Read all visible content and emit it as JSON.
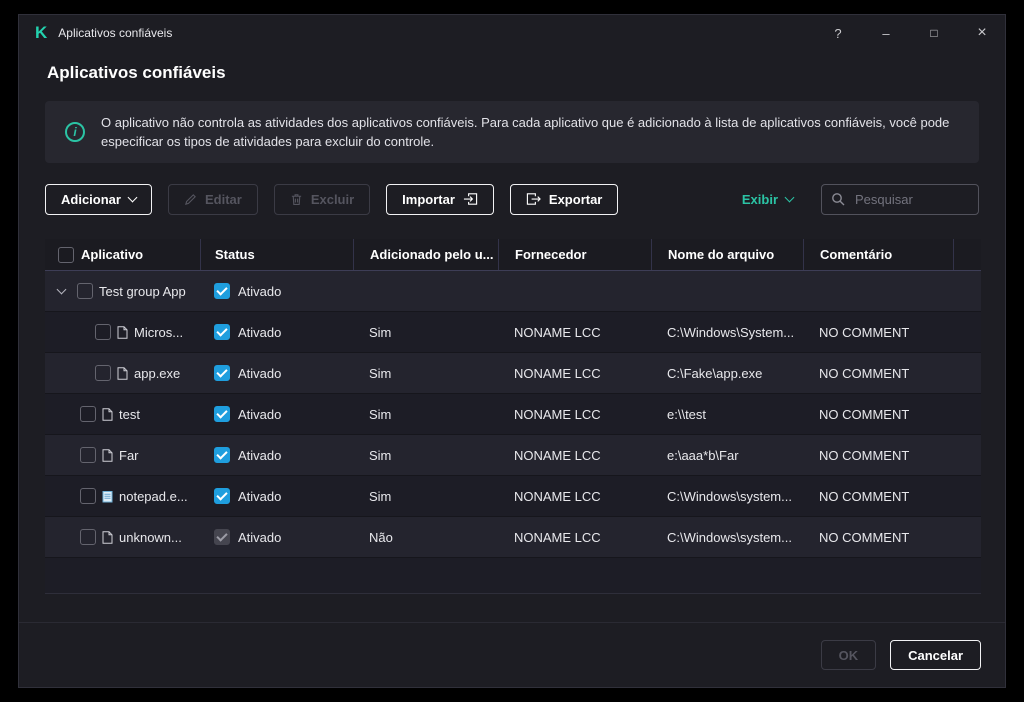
{
  "window": {
    "logo": "K",
    "title": "Aplicativos confiáveis",
    "controls": {
      "help": "?",
      "minimize": "–",
      "maximize": "□",
      "close": "×"
    }
  },
  "page": {
    "heading": "Aplicativos confiáveis",
    "banner_text": "O aplicativo não controla as atividades dos aplicativos confiáveis. Para cada aplicativo que é adicionado à lista de aplicativos confiáveis, você pode especificar os tipos de atividades para excluir do controle."
  },
  "toolbar": {
    "add_label": "Adicionar",
    "edit_label": "Editar",
    "delete_label": "Excluir",
    "import_label": "Importar",
    "export_label": "Exportar",
    "view_label": "Exibir",
    "search_placeholder": "Pesquisar"
  },
  "table": {
    "columns": {
      "app": "Aplicativo",
      "status": "Status",
      "added_by_user": "Adicionado pelo u...",
      "vendor": "Fornecedor",
      "file_name": "Nome do arquivo",
      "comment": "Comentário"
    },
    "group_row": {
      "name": "Test group App",
      "status_label": "Ativado"
    },
    "rows": [
      {
        "name": "Micros...",
        "status_label": "Ativado",
        "added": "Sim",
        "vendor": "NONAME LCC",
        "file": "C:\\Windows\\System...",
        "comment": "NO COMMENT"
      },
      {
        "name": "app.exe",
        "status_label": "Ativado",
        "added": "Sim",
        "vendor": "NONAME LCC",
        "file": "C:\\Fake\\app.exe",
        "comment": "NO COMMENT"
      },
      {
        "name": "test",
        "status_label": "Ativado",
        "added": "Sim",
        "vendor": "NONAME LCC",
        "file": "e:\\\\test",
        "comment": "NO COMMENT"
      },
      {
        "name": "Far",
        "status_label": "Ativado",
        "added": "Sim",
        "vendor": "NONAME LCC",
        "file": "e:\\aaa*b\\Far",
        "comment": "NO COMMENT"
      },
      {
        "name": "notepad.e...",
        "status_label": "Ativado",
        "added": "Sim",
        "vendor": "NONAME LCC",
        "file": "C:\\Windows\\system...",
        "comment": "NO COMMENT"
      },
      {
        "name": "unknown...",
        "status_label": "Ativado",
        "added": "Não",
        "vendor": "NONAME LCC",
        "file": "C:\\Windows\\system...",
        "comment": "NO COMMENT"
      }
    ]
  },
  "footer": {
    "ok_label": "OK",
    "cancel_label": "Cancelar"
  },
  "colors": {
    "accent_teal": "#2bc4a5",
    "checkbox_blue": "#1f9ede"
  }
}
